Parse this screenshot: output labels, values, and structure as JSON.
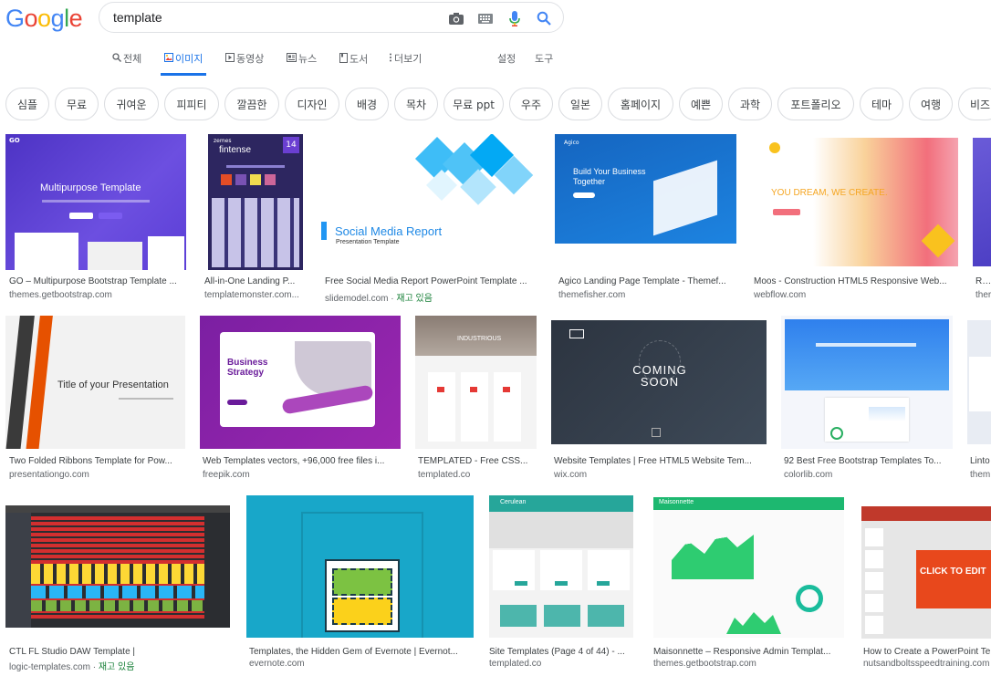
{
  "search": {
    "query": "template"
  },
  "tabs": [
    {
      "label": "전체"
    },
    {
      "label": "이미지"
    },
    {
      "label": "동영상"
    },
    {
      "label": "뉴스"
    },
    {
      "label": "도서"
    },
    {
      "label": "더보기"
    },
    {
      "label": "설정"
    },
    {
      "label": "도구"
    }
  ],
  "chips": [
    "심플",
    "무료",
    "귀여운",
    "피피티",
    "깔끔한",
    "디자인",
    "배경",
    "목차",
    "무료 ppt",
    "우주",
    "일본",
    "홈페이지",
    "예쁜",
    "과학",
    "포트폴리오",
    "테마",
    "여행",
    "비즈"
  ],
  "results": [
    {
      "caption": "GO – Multipurpose Bootstrap Template ...",
      "source": "themes.getbootstrap.com",
      "thumb_text": "Multipurpose Template"
    },
    {
      "caption": "All-in-One Landing P...",
      "source": "templatemonster.com...",
      "thumb_text": "fintense"
    },
    {
      "caption": "Free Social Media Report PowerPoint Template ...",
      "source": "slidemodel.com",
      "stock": "재고 있음",
      "thumb_text": "Social Media Report",
      "thumb_sub": "Presentation Template"
    },
    {
      "caption": "Agico Landing Page Template - Themef...",
      "source": "themefisher.com",
      "thumb_text": "Build Your Business Together"
    },
    {
      "caption": "Moos - Construction HTML5 Responsive Web...",
      "source": "webflow.com",
      "thumb_text": "YOU DREAM, WE CREATE."
    },
    {
      "caption": "Rox",
      "source": "ther"
    },
    {
      "caption": "Two Folded Ribbons Template for Pow...",
      "source": "presentationgo.com",
      "thumb_text": "Title of your Presentation"
    },
    {
      "caption": "Web Templates vectors, +96,000 free files i...",
      "source": "freepik.com",
      "thumb_text": "Business Strategy"
    },
    {
      "caption": "TEMPLATED - Free CSS...",
      "source": "templated.co",
      "thumb_text": "INDUSTRIOUS"
    },
    {
      "caption": "Website Templates | Free HTML5 Website Tem...",
      "source": "wix.com",
      "thumb_text": "COMING SOON"
    },
    {
      "caption": "92 Best Free Bootstrap Templates To...",
      "source": "colorlib.com"
    },
    {
      "caption": "Linto",
      "source": "them"
    },
    {
      "caption": "CTL FL Studio DAW Template |",
      "source": "logic-templates.com",
      "stock": "재고 있음"
    },
    {
      "caption": "Templates, the Hidden Gem of Evernote | Evernot...",
      "source": "evernote.com"
    },
    {
      "caption": "Site Templates (Page 4 of 44) - ...",
      "source": "templated.co",
      "thumb_text": "Cerulean"
    },
    {
      "caption": "Maisonnette – Responsive Admin Templat...",
      "source": "themes.getbootstrap.com",
      "thumb_text": "Maisonnette"
    },
    {
      "caption": "How to Create a PowerPoint Te",
      "source": "nutsandboltsspeedtraining.com",
      "thumb_text": "CLICK TO EDIT"
    }
  ],
  "colors": {
    "blue": "#4285F4",
    "red": "#EA4335",
    "yellow": "#FBBC05",
    "green": "#34A853",
    "accent": "#1a73e8"
  }
}
